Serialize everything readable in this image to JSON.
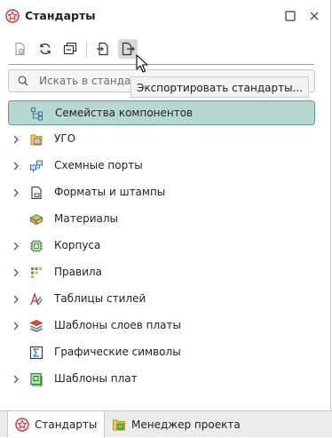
{
  "panel": {
    "title": "Стандарты",
    "title_icon": "standards-logo-icon",
    "restore_icon": "restore-icon",
    "close_icon": "close-icon"
  },
  "toolbar": {
    "buttons": [
      {
        "name": "import-standard-icon"
      },
      {
        "name": "refresh-icon"
      },
      {
        "name": "collapse-all-icon"
      },
      {
        "name": "import-standards-icon"
      },
      {
        "name": "export-standards-icon",
        "active": true
      }
    ],
    "tooltip": "Экспортировать стандарты..."
  },
  "search": {
    "placeholder": "Искать в стандартах"
  },
  "tree": {
    "items": [
      {
        "label": "Семейства компонентов",
        "icon": "component-families-icon",
        "has_children": false,
        "selected": true
      },
      {
        "label": "УГО",
        "icon": "ugo-icon",
        "has_children": true
      },
      {
        "label": "Схемные порты",
        "icon": "schematic-ports-icon",
        "has_children": true
      },
      {
        "label": "Форматы и штампы",
        "icon": "formats-stamps-icon",
        "has_children": true
      },
      {
        "label": "Материалы",
        "icon": "materials-icon",
        "has_children": false
      },
      {
        "label": "Корпуса",
        "icon": "packages-icon",
        "has_children": true
      },
      {
        "label": "Правила",
        "icon": "rules-icon",
        "has_children": true
      },
      {
        "label": "Таблицы стилей",
        "icon": "style-tables-icon",
        "has_children": true
      },
      {
        "label": "Шаблоны слоев платы",
        "icon": "board-layer-templates-icon",
        "has_children": true
      },
      {
        "label": "Графические символы",
        "icon": "graphic-symbols-icon",
        "has_children": false
      },
      {
        "label": "Шаблоны плат",
        "icon": "board-templates-icon",
        "has_children": true
      }
    ]
  },
  "tabs": [
    {
      "label": "Стандарты",
      "icon": "standards-logo-icon",
      "active": true
    },
    {
      "label": "Менеджер проекта",
      "icon": "project-manager-icon",
      "active": false
    }
  ],
  "colors": {
    "selection_bg": "#b7d7d3",
    "selection_border": "#5c9f97",
    "brand_red": "#d23c3c"
  }
}
